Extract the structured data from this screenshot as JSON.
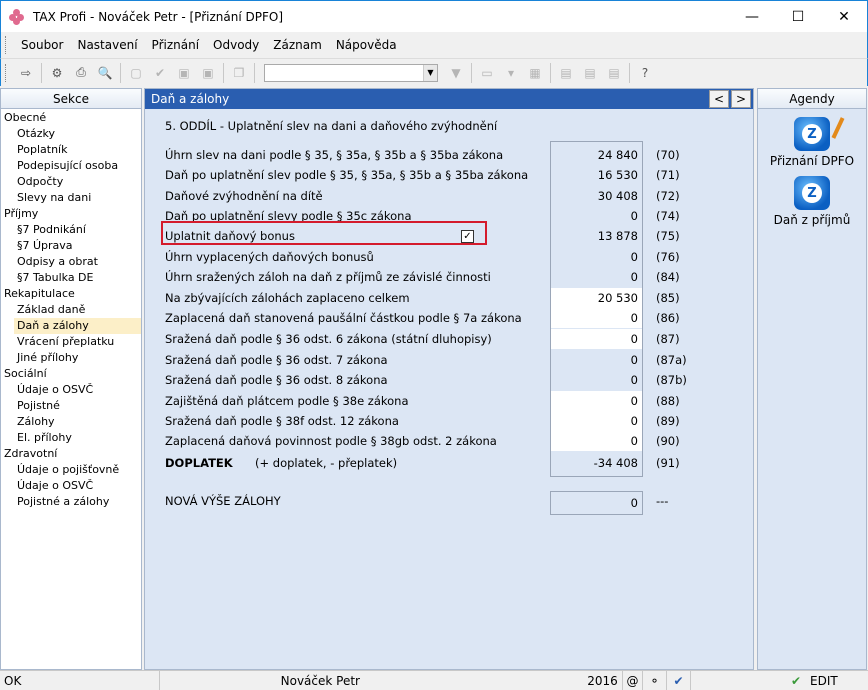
{
  "window": {
    "title": "TAX Profi - Nováček Petr - [Přiznání DPFO]"
  },
  "menu": [
    "Soubor",
    "Nastavení",
    "Přiznání",
    "Odvody",
    "Záznam",
    "Nápověda"
  ],
  "left_panel": {
    "header": "Sekce",
    "items": [
      {
        "label": "Obecné",
        "level": 0
      },
      {
        "label": "Otázky",
        "level": 1
      },
      {
        "label": "Poplatník",
        "level": 1
      },
      {
        "label": "Podepisující osoba",
        "level": 1
      },
      {
        "label": "Odpočty",
        "level": 1
      },
      {
        "label": "Slevy na dani",
        "level": 1
      },
      {
        "label": "Příjmy",
        "level": 0
      },
      {
        "label": "§7 Podnikání",
        "level": 1
      },
      {
        "label": "§7 Úprava",
        "level": 1
      },
      {
        "label": "Odpisy a obrat",
        "level": 1
      },
      {
        "label": "§7 Tabulka DE",
        "level": 1
      },
      {
        "label": "Rekapitulace",
        "level": 0
      },
      {
        "label": "Základ daně",
        "level": 1
      },
      {
        "label": "Daň a zálohy",
        "level": 1,
        "selected": true
      },
      {
        "label": "Vrácení přeplatku",
        "level": 1
      },
      {
        "label": "Jiné přílohy",
        "level": 1
      },
      {
        "label": "Sociální",
        "level": 0
      },
      {
        "label": "Údaje o OSVČ",
        "level": 1
      },
      {
        "label": "Pojistné",
        "level": 1
      },
      {
        "label": "Zálohy",
        "level": 1
      },
      {
        "label": "El. přílohy",
        "level": 1
      },
      {
        "label": "Zdravotní",
        "level": 0
      },
      {
        "label": "Údaje o pojišťovně",
        "level": 1
      },
      {
        "label": "Údaje o OSVČ",
        "level": 1
      },
      {
        "label": "Pojistné a zálohy",
        "level": 1
      }
    ]
  },
  "center": {
    "header": "Daň a zálohy",
    "prev": "<",
    "next": ">",
    "section_title": "5. ODDÍL - Uplatnění slev na dani a daňového zvýhodnění",
    "rows": [
      {
        "label": "Úhrn slev na dani podle § 35, § 35a, § 35b a § 35ba zákona",
        "value": "24 840",
        "code": "(70)",
        "editable": false
      },
      {
        "label": "Daň po uplatnění slev podle § 35, § 35a, § 35b a § 35ba zákona",
        "value": "16 530",
        "code": "(71)",
        "editable": false
      },
      {
        "label": "Daňové zvýhodnění na dítě",
        "value": "30 408",
        "code": "(72)",
        "editable": false
      },
      {
        "label": "Daň po uplatnění slevy podle § 35c zákona",
        "value": "0",
        "code": "(74)",
        "editable": false
      },
      {
        "label": "Uplatnit daňový bonus",
        "value": "13 878",
        "code": "(75)",
        "editable": false,
        "checkbox": "✓"
      },
      {
        "label": "Úhrn vyplacených daňových bonusů",
        "value": "0",
        "code": "(76)",
        "editable": false
      },
      {
        "label": "Úhrn sražených záloh na daň z příjmů ze závislé činnosti",
        "value": "0",
        "code": "(84)",
        "editable": false
      },
      {
        "label": "Na zbývajících zálohách zaplaceno celkem",
        "value": "20 530",
        "code": "(85)",
        "editable": true
      },
      {
        "label": "Zaplacená daň stanovená paušální částkou podle § 7a zákona",
        "value": "0",
        "code": "(86)",
        "editable": true
      },
      {
        "label": "Sražená daň podle § 36 odst. 6 zákona (státní dluhopisy)",
        "value": "0",
        "code": "(87)",
        "editable": true
      },
      {
        "label": "Sražená daň podle § 36 odst. 7 zákona",
        "value": "0",
        "code": "(87a)",
        "editable": false
      },
      {
        "label": "Sražená daň podle § 36 odst. 8 zákona",
        "value": "0",
        "code": "(87b)",
        "editable": false
      },
      {
        "label": "Zajištěná daň plátcem podle § 38e zákona",
        "value": "0",
        "code": "(88)",
        "editable": true
      },
      {
        "label": "Sražená daň podle § 38f odst. 12 zákona",
        "value": "0",
        "code": "(89)",
        "editable": true
      },
      {
        "label": "Zaplacená daňová povinnost podle § 38gb odst. 2 zákona",
        "value": "0",
        "code": "(90)",
        "editable": true
      },
      {
        "label": "DOPLATEK",
        "note": "(+ doplatek, - přeplatek)",
        "value": "-34 408",
        "code": "(91)",
        "editable": false,
        "bold": true
      }
    ],
    "nova": {
      "label": "NOVÁ VÝŠE ZÁLOHY",
      "value": "0",
      "code": "---"
    }
  },
  "right_panel": {
    "header": "Agendy",
    "items": [
      {
        "label": "Přiznání DPFO",
        "icon": "dpfo-icon"
      },
      {
        "label": "Daň z příjmů",
        "icon": "dan-icon"
      }
    ]
  },
  "status": {
    "state": "OK",
    "user": "Nováček Petr",
    "year": "2016",
    "at": "@",
    "mode": "EDIT"
  }
}
